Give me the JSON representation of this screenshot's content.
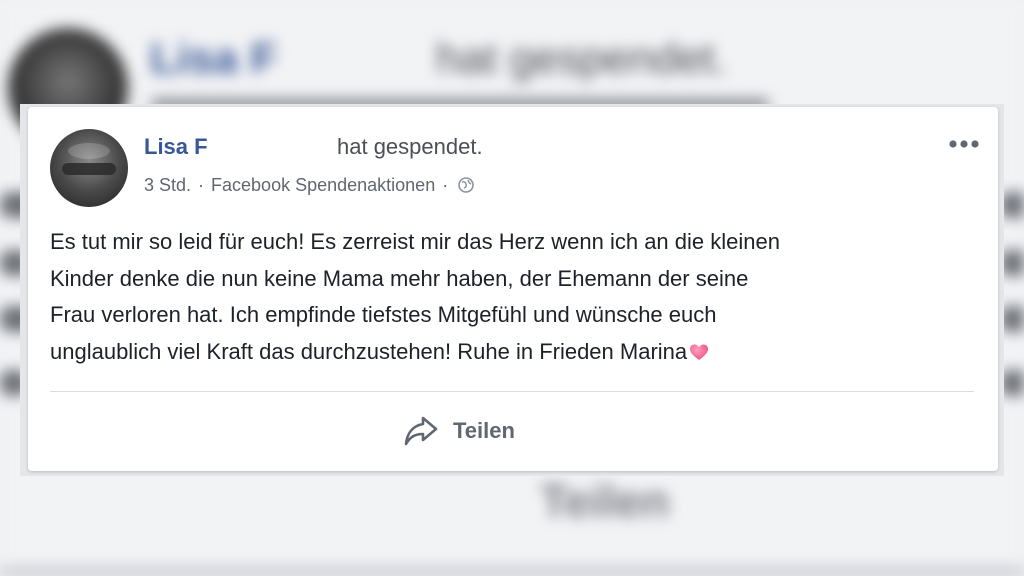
{
  "post": {
    "author_name": "Lisa F",
    "action_text": "hat gespendet.",
    "timestamp": "3 Std.",
    "separator": "·",
    "source": "Facebook Spendenaktionen",
    "privacy_icon": "globe-icon",
    "more_icon": "ellipsis-icon",
    "body_lines": [
      "Es tut mir so leid für euch! Es zerreist mir das Herz wenn ich an die kleinen",
      "Kinder denke die nun keine Mama mehr haben, der Ehemann der seine",
      "Frau verloren hat. Ich empfinde tiefstes Mitgefühl und wünsche euch",
      "unglaublich viel Kraft das durchzustehen! Ruhe in Frieden Marina"
    ],
    "body_emoji": "heart-icon",
    "share_label": "Teilen",
    "share_icon": "share-arrow-icon"
  },
  "background": {
    "author_name": "Lisa F",
    "action_text": "hat gespendet.",
    "share_label": "Teilen"
  },
  "colors": {
    "name_link": "#365899",
    "text": "#1d2129",
    "meta": "#616770",
    "heart": "#f25c8f"
  }
}
